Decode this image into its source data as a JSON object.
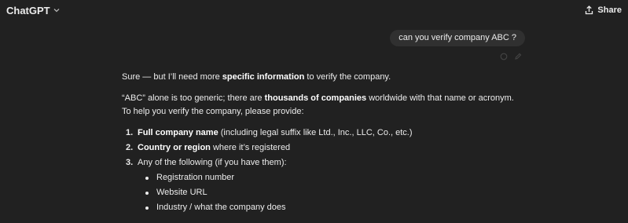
{
  "header": {
    "model_name": "ChatGPT",
    "share_label": "Share"
  },
  "user_message": "can you verify company ABC ?",
  "assistant": {
    "p1": {
      "pre": "Sure — but I’ll need more ",
      "bold": "specific information",
      "post": " to verify the company."
    },
    "p2": {
      "pre": "“ABC” alone is too generic; there are ",
      "bold": "thousands of companies",
      "post": " worldwide with that name or acronym. To help you verify the company, please provide:"
    },
    "list": [
      {
        "num": "1.",
        "bold": "Full company name",
        "rest": " (including legal suffix like Ltd., Inc., LLC, Co., etc.)"
      },
      {
        "num": "2.",
        "bold": "Country or region",
        "rest": " where it’s registered"
      },
      {
        "num": "3.",
        "bold": "",
        "rest": "Any of the following (if you have them):"
      }
    ],
    "sublist": [
      "Registration number",
      "Website URL",
      "Industry / what the company does"
    ]
  },
  "icons": {
    "model_chevron": "chevron-down-icon",
    "share": "share-icon",
    "copy": "copy-icon",
    "edit": "edit-icon"
  }
}
